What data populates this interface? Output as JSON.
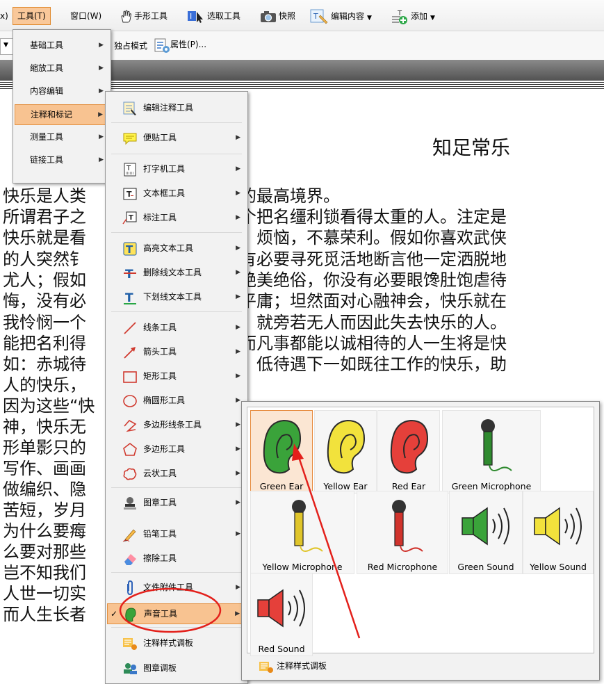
{
  "menubar": {
    "partial_left": "x)",
    "tools": "工具(T)",
    "window": "窗口(W)",
    "hand_tool": "手形工具",
    "select_tool": "选取工具",
    "snapshot": "快照",
    "edit_content": "编辑内容",
    "add": "添加"
  },
  "toolbar2": {
    "exclusive_mode": "独占模式",
    "properties": "属性(P)..."
  },
  "tools_menu": {
    "items": [
      "基础工具",
      "缩放工具",
      "内容编辑",
      "注释和标记",
      "测量工具",
      "链接工具"
    ]
  },
  "annot_menu": {
    "items": [
      {
        "label": "编辑注释工具",
        "icon": "edit-annotation-icon",
        "arrow": false
      },
      {
        "label": "便贴工具",
        "icon": "sticky-note-icon",
        "arrow": true
      },
      {
        "label": "打字机工具",
        "icon": "typewriter-icon",
        "arrow": true
      },
      {
        "label": "文本框工具",
        "icon": "textbox-icon",
        "arrow": true
      },
      {
        "label": "标注工具",
        "icon": "callout-icon",
        "arrow": true
      },
      {
        "label": "高亮文本工具",
        "icon": "highlight-icon",
        "arrow": true
      },
      {
        "label": "删除线文本工具",
        "icon": "strikeout-icon",
        "arrow": true
      },
      {
        "label": "下划线文本工具",
        "icon": "underline-icon",
        "arrow": true
      },
      {
        "label": "线条工具",
        "icon": "line-icon",
        "arrow": true
      },
      {
        "label": "箭头工具",
        "icon": "arrow-icon",
        "arrow": true
      },
      {
        "label": "矩形工具",
        "icon": "rectangle-icon",
        "arrow": true
      },
      {
        "label": "椭圆形工具",
        "icon": "ellipse-icon",
        "arrow": true
      },
      {
        "label": "多边形线条工具",
        "icon": "polyline-icon",
        "arrow": true
      },
      {
        "label": "多边形工具",
        "icon": "polygon-icon",
        "arrow": true
      },
      {
        "label": "云状工具",
        "icon": "cloud-icon",
        "arrow": true
      },
      {
        "label": "图章工具",
        "icon": "stamp-icon",
        "arrow": true
      },
      {
        "label": "铅笔工具",
        "icon": "pencil-icon",
        "arrow": true
      },
      {
        "label": "擦除工具",
        "icon": "eraser-icon",
        "arrow": false
      },
      {
        "label": "文件附件工具",
        "icon": "paperclip-icon",
        "arrow": true
      },
      {
        "label": "声音工具",
        "icon": "ear-icon",
        "arrow": true
      },
      {
        "label": "注释样式调板",
        "icon": "style-palette-icon",
        "arrow": false
      },
      {
        "label": "图章调板",
        "icon": "stamp-palette-icon",
        "arrow": false
      }
    ]
  },
  "sound_palette": {
    "items": [
      {
        "label": "Green Ear",
        "kind": "ear",
        "color": "#3aa33a"
      },
      {
        "label": "Yellow Ear",
        "kind": "ear",
        "color": "#f2e23c"
      },
      {
        "label": "Red Ear",
        "kind": "ear",
        "color": "#e5403a"
      },
      {
        "label": "Green Microphone",
        "kind": "mic",
        "color": "#2f8a2f"
      },
      {
        "label": "Yellow Microphone",
        "kind": "mic",
        "color": "#e0c52a"
      },
      {
        "label": "Red Microphone",
        "kind": "mic",
        "color": "#d0332c"
      },
      {
        "label": "Green Sound",
        "kind": "speaker",
        "color": "#3aa33a"
      },
      {
        "label": "Yellow Sound",
        "kind": "speaker",
        "color": "#f2e23c"
      },
      {
        "label": "Red Sound",
        "kind": "speaker",
        "color": "#e5403a"
      }
    ],
    "footer": "注释样式调板"
  },
  "document": {
    "title": "知足常乐",
    "lines": [
      {
        "left": "快乐是人类",
        "right": "的最高境界。"
      },
      {
        "left": "所谓君子之",
        "right": "个把名缰利锁看得太重的人。注定是"
      },
      {
        "left": "快乐就是看",
        "right": "、烦恼，不慕荣利。假如你喜欢武侠"
      },
      {
        "left": "的人突然钅",
        "right": "有必要寻死觅活地断言他一定洒脱地"
      },
      {
        "left": "尤人；假如",
        "right": "艳美绝俗，你没有必要眼馋肚饱虐待"
      },
      {
        "left": "悔，没有必",
        "right": "平庸；坦然面对心融神会，快乐就在"
      },
      {
        "left": "我怜悯一个",
        "right": "，就旁若无人而因此失去快乐的人。"
      },
      {
        "left": "能把名利得",
        "right": "而凡事都能以诚相待的人一生将是快"
      },
      {
        "left": "如：赤城待",
        "right": "。低待遇下一如既往工作的快乐，助"
      },
      {
        "left": "人的快乐，",
        "right": ""
      },
      {
        "left": "因为这些“快",
        "right": ""
      },
      {
        "left": "神，快乐无",
        "right": ""
      },
      {
        "left": "形单影只的",
        "right": ""
      },
      {
        "left": "写作、画画",
        "right": ""
      },
      {
        "left": "做编织、隐",
        "right": ""
      },
      {
        "left": "苦短，岁月",
        "right": ""
      },
      {
        "left": "为什么要痗",
        "right": ""
      },
      {
        "left": "么要对那些",
        "right": ""
      },
      {
        "left": "岂不知我们",
        "right": ""
      },
      {
        "left": "人世一切实",
        "right": ""
      },
      {
        "left": "而人生长者",
        "right": ""
      }
    ]
  }
}
